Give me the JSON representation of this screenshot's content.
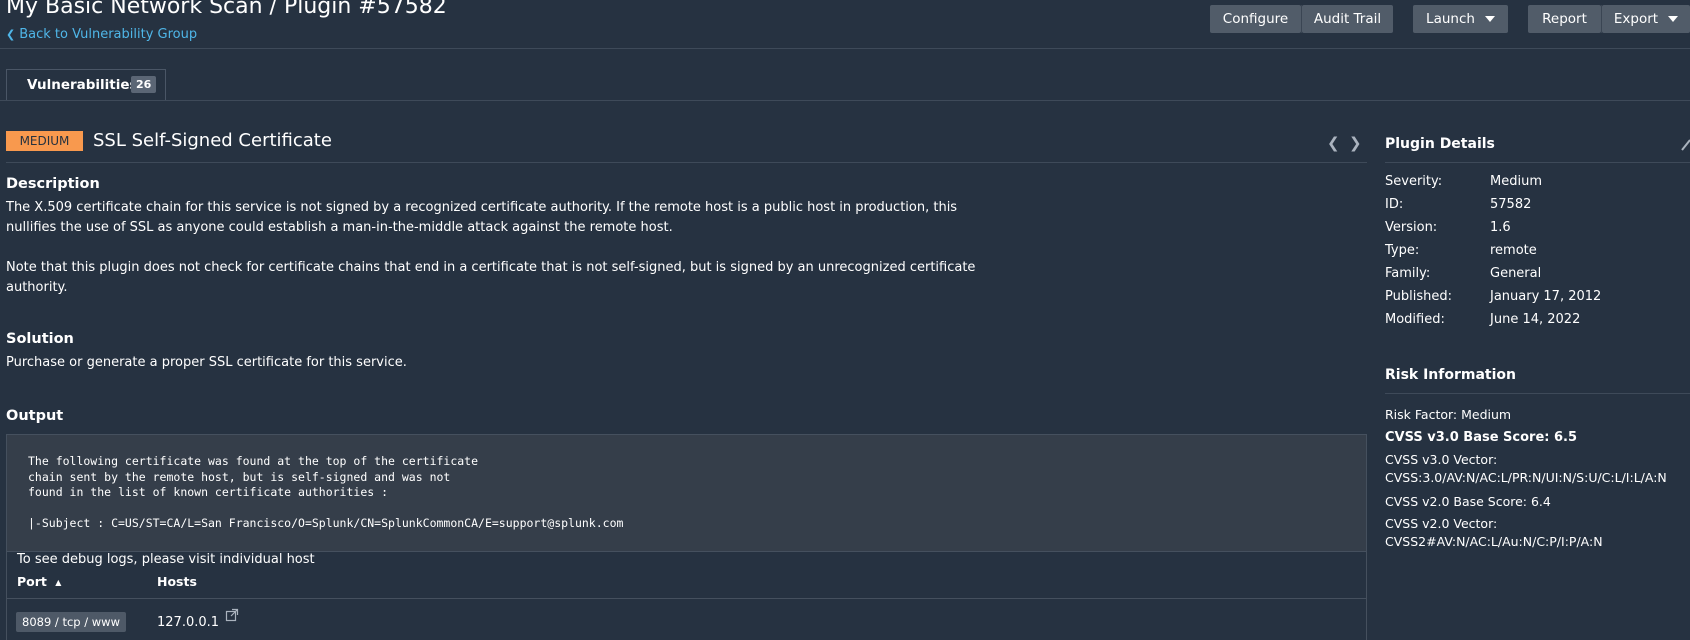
{
  "header": {
    "title": "My Basic Network Scan / Plugin #57582",
    "back_link": "Back to Vulnerability Group"
  },
  "toolbar": {
    "configure": "Configure",
    "audit_trail": "Audit Trail",
    "launch": "Launch",
    "report": "Report",
    "export": "Export"
  },
  "tab": {
    "label": "Vulnerabilities",
    "count": "26"
  },
  "plugin": {
    "severity": "MEDIUM",
    "name": "SSL Self-Signed Certificate"
  },
  "description": {
    "heading": "Description",
    "line1": "The X.509 certificate chain for this service is not signed by a recognized certificate authority. If the remote host is a public host in production, this",
    "line2": "nullifies the use of SSL as anyone could establish a man-in-the-middle attack against the remote host.",
    "line3": "Note that this plugin does not check for certificate chains that end in a certificate that is not self-signed, but is signed by an unrecognized certificate",
    "line4": "authority."
  },
  "solution": {
    "heading": "Solution",
    "text": "Purchase or generate a proper SSL certificate for this service."
  },
  "output": {
    "heading": "Output",
    "text": "The following certificate was found at the top of the certificate\nchain sent by the remote host, but is self-signed and was not\nfound in the list of known certificate authorities :\n\n|-Subject : C=US/ST=CA/L=San Francisco/O=Splunk/CN=SplunkCommonCA/E=support@splunk.com",
    "debug_note": "To see debug logs, please visit individual host",
    "col_port": "Port",
    "col_hosts": "Hosts",
    "port_value": "8089 / tcp / www",
    "host_value": "127.0.0.1"
  },
  "plugin_details": {
    "heading": "Plugin Details",
    "severity_label": "Severity:",
    "severity_value": "Medium",
    "id_label": "ID:",
    "id_value": "57582",
    "version_label": "Version:",
    "version_value": "1.6",
    "type_label": "Type:",
    "type_value": "remote",
    "family_label": "Family:",
    "family_value": "General",
    "published_label": "Published:",
    "published_value": "January 17, 2012",
    "modified_label": "Modified:",
    "modified_value": "June 14, 2022"
  },
  "risk_info": {
    "heading": "Risk Information",
    "risk_factor": "Risk Factor: Medium",
    "cvss3_base": "CVSS v3.0 Base Score: 6.5",
    "cvss3_vector_label": "CVSS v3.0 Vector:",
    "cvss3_vector": "CVSS:3.0/AV:N/AC:L/PR:N/UI:N/S:U/C:L/I:L/A:N",
    "cvss2_base": "CVSS v2.0 Base Score: 6.4",
    "cvss2_vector_label": "CVSS v2.0 Vector:",
    "cvss2_vector": "CVSS2#AV:N/AC:L/Au:N/C:P/I:P/A:N"
  },
  "colors": {
    "background": "#263241",
    "link": "#4fb6e8",
    "severity_medium": "#f8994e",
    "button": "#515c69"
  },
  "icons": {
    "back": "chevron-left-icon",
    "launch_caret": "caret-down-icon",
    "export_caret": "caret-down-icon",
    "prev": "chevron-left-icon",
    "next": "chevron-right-icon",
    "sort": "sort-asc-icon",
    "external": "external-link-icon",
    "edit": "pencil-icon"
  }
}
